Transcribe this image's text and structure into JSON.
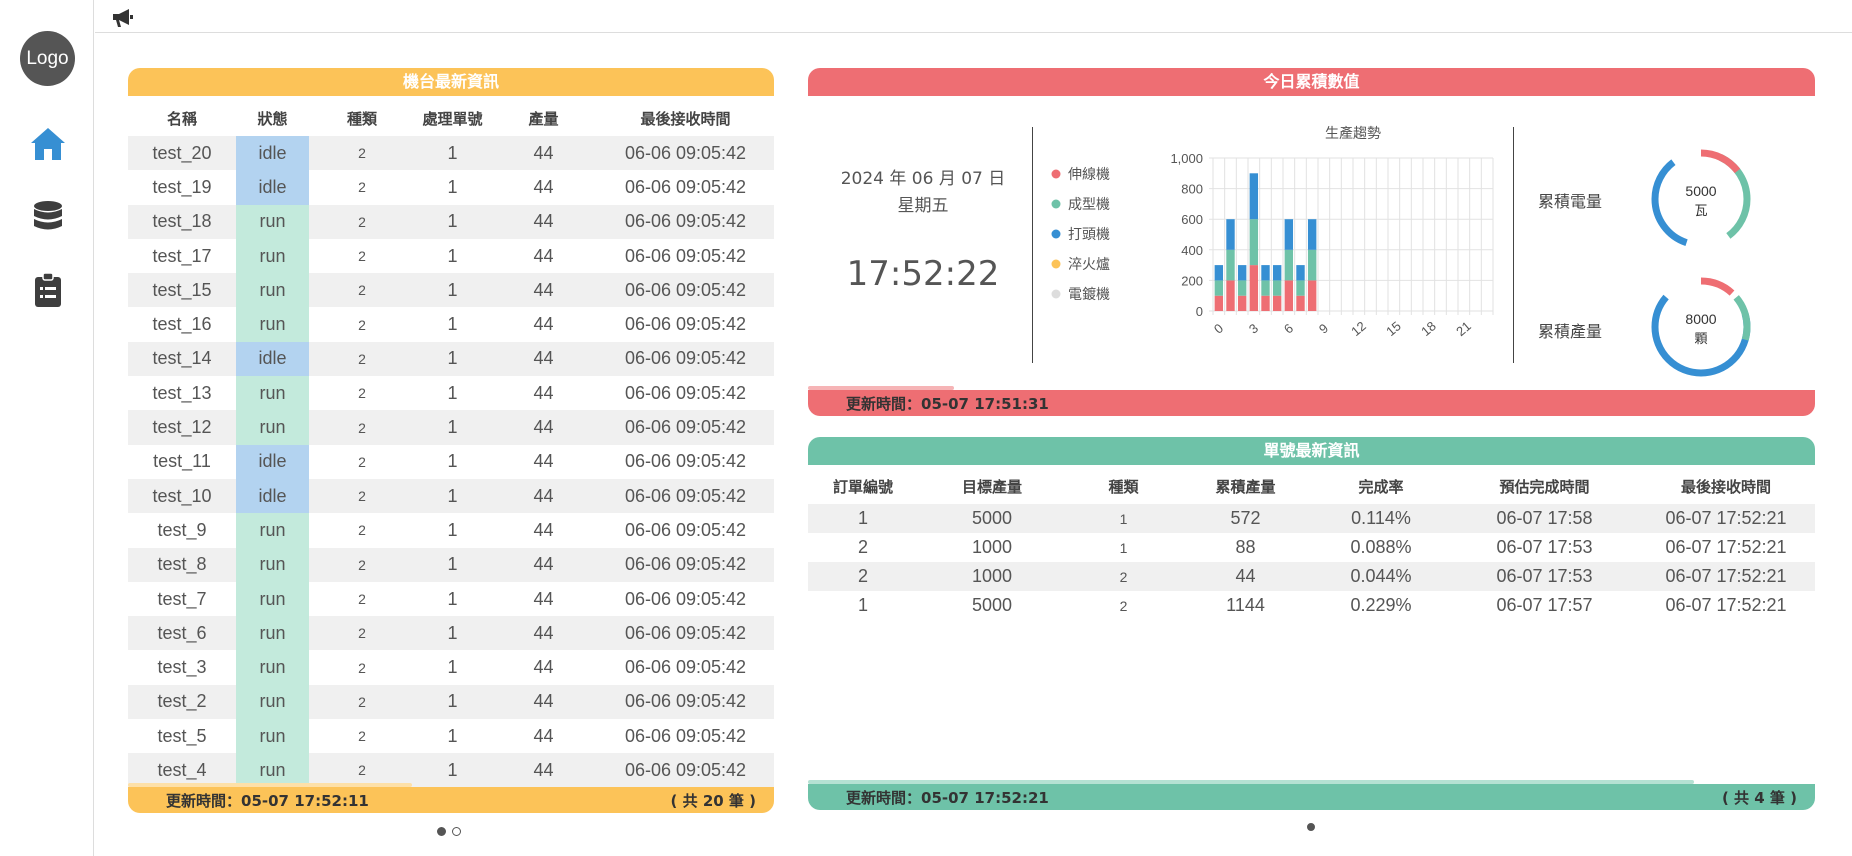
{
  "sidebar": {
    "logo": "Logo"
  },
  "machine_panel": {
    "title": "機台最新資訊",
    "columns": [
      "名稱",
      "狀態",
      "種類",
      "處理單號",
      "產量",
      "最後接收時間"
    ],
    "rows": [
      {
        "name": "test_20",
        "status": "idle",
        "type": "2",
        "order": "1",
        "output": "44",
        "time": "06-06 09:05:42"
      },
      {
        "name": "test_19",
        "status": "idle",
        "type": "2",
        "order": "1",
        "output": "44",
        "time": "06-06 09:05:42"
      },
      {
        "name": "test_18",
        "status": "run",
        "type": "2",
        "order": "1",
        "output": "44",
        "time": "06-06 09:05:42"
      },
      {
        "name": "test_17",
        "status": "run",
        "type": "2",
        "order": "1",
        "output": "44",
        "time": "06-06 09:05:42"
      },
      {
        "name": "test_15",
        "status": "run",
        "type": "2",
        "order": "1",
        "output": "44",
        "time": "06-06 09:05:42"
      },
      {
        "name": "test_16",
        "status": "run",
        "type": "2",
        "order": "1",
        "output": "44",
        "time": "06-06 09:05:42"
      },
      {
        "name": "test_14",
        "status": "idle",
        "type": "2",
        "order": "1",
        "output": "44",
        "time": "06-06 09:05:42"
      },
      {
        "name": "test_13",
        "status": "run",
        "type": "2",
        "order": "1",
        "output": "44",
        "time": "06-06 09:05:42"
      },
      {
        "name": "test_12",
        "status": "run",
        "type": "2",
        "order": "1",
        "output": "44",
        "time": "06-06 09:05:42"
      },
      {
        "name": "test_11",
        "status": "idle",
        "type": "2",
        "order": "1",
        "output": "44",
        "time": "06-06 09:05:42"
      },
      {
        "name": "test_10",
        "status": "idle",
        "type": "2",
        "order": "1",
        "output": "44",
        "time": "06-06 09:05:42"
      },
      {
        "name": "test_9",
        "status": "run",
        "type": "2",
        "order": "1",
        "output": "44",
        "time": "06-06 09:05:42"
      },
      {
        "name": "test_8",
        "status": "run",
        "type": "2",
        "order": "1",
        "output": "44",
        "time": "06-06 09:05:42"
      },
      {
        "name": "test_7",
        "status": "run",
        "type": "2",
        "order": "1",
        "output": "44",
        "time": "06-06 09:05:42"
      },
      {
        "name": "test_6",
        "status": "run",
        "type": "2",
        "order": "1",
        "output": "44",
        "time": "06-06 09:05:42"
      },
      {
        "name": "test_3",
        "status": "run",
        "type": "2",
        "order": "1",
        "output": "44",
        "time": "06-06 09:05:42"
      },
      {
        "name": "test_2",
        "status": "run",
        "type": "2",
        "order": "1",
        "output": "44",
        "time": "06-06 09:05:42"
      },
      {
        "name": "test_5",
        "status": "run",
        "type": "2",
        "order": "1",
        "output": "44",
        "time": "06-06 09:05:42"
      },
      {
        "name": "test_4",
        "status": "run",
        "type": "2",
        "order": "1",
        "output": "44",
        "time": "06-06 09:05:42"
      }
    ],
    "footer_update": "更新時間：05-07 17:52:11",
    "footer_count": "( 共 20 筆 )",
    "refresh_progress": 0.44
  },
  "daily_panel": {
    "title": "今日累積數值",
    "date": "2024 年 06 月 07 日",
    "weekday": "星期五",
    "time": "17:52:22",
    "footer_update": "更新時間：05-07 17:51:31",
    "refresh_progress": 0.145,
    "gauges": [
      {
        "label": "累積電量",
        "value": "5000",
        "unit": "瓦"
      },
      {
        "label": "累積產量",
        "value": "8000",
        "unit": "顆"
      }
    ]
  },
  "order_panel": {
    "title": "單號最新資訊",
    "columns": [
      "訂單編號",
      "目標產量",
      "種類",
      "累積產量",
      "完成率",
      "預估完成時間",
      "最後接收時間"
    ],
    "rows": [
      {
        "order": "1",
        "target": "5000",
        "type": "1",
        "accum": "572",
        "rate": "0.114%",
        "eta": "06-07 17:58",
        "last": "06-07 17:52:21"
      },
      {
        "order": "2",
        "target": "1000",
        "type": "1",
        "accum": "88",
        "rate": "0.088%",
        "eta": "06-07 17:53",
        "last": "06-07 17:52:21"
      },
      {
        "order": "2",
        "target": "1000",
        "type": "2",
        "accum": "44",
        "rate": "0.044%",
        "eta": "06-07 17:53",
        "last": "06-07 17:52:21"
      },
      {
        "order": "1",
        "target": "5000",
        "type": "2",
        "accum": "1144",
        "rate": "0.229%",
        "eta": "06-07 17:57",
        "last": "06-07 17:52:21"
      }
    ],
    "footer_update": "更新時間：05-07 17:52:21",
    "footer_count": "( 共 4 筆 )",
    "refresh_progress": 0.88
  },
  "colors": {
    "yellow": "#fcc358",
    "red": "#ee6e73",
    "teal": "#6ec2a8",
    "blue": "#368fd3",
    "gray": "#dddddd"
  },
  "chart_data": {
    "type": "bar",
    "stacked": true,
    "title": "生產趨勢",
    "x": [
      0,
      1,
      2,
      3,
      4,
      5,
      6,
      7,
      8,
      9,
      10,
      11,
      12,
      13,
      14,
      15,
      16,
      17,
      18,
      19,
      20,
      21,
      22,
      23
    ],
    "x_tick_labels": [
      "0",
      "3",
      "6",
      "9",
      "12",
      "15",
      "18",
      "21"
    ],
    "ylim": [
      0,
      1000
    ],
    "y_tick_labels": [
      "0",
      "200",
      "400",
      "600",
      "800",
      "1,000"
    ],
    "legend_position": "left",
    "grid": true,
    "series": [
      {
        "name": "伸線機",
        "color": "#ee6e73",
        "values": [
          100,
          200,
          100,
          300,
          100,
          100,
          200,
          100,
          200,
          0,
          0,
          0,
          0,
          0,
          0,
          0,
          0,
          0,
          0,
          0,
          0,
          0,
          0,
          0
        ]
      },
      {
        "name": "成型機",
        "color": "#6ec2a8",
        "values": [
          100,
          200,
          100,
          300,
          100,
          100,
          200,
          100,
          200,
          0,
          0,
          0,
          0,
          0,
          0,
          0,
          0,
          0,
          0,
          0,
          0,
          0,
          0,
          0
        ]
      },
      {
        "name": "打頭機",
        "color": "#368fd3",
        "values": [
          100,
          200,
          100,
          300,
          100,
          100,
          200,
          100,
          200,
          0,
          0,
          0,
          0,
          0,
          0,
          0,
          0,
          0,
          0,
          0,
          0,
          0,
          0,
          0
        ]
      },
      {
        "name": "淬火爐",
        "color": "#fcc358",
        "values": [
          0,
          0,
          0,
          0,
          0,
          0,
          0,
          0,
          0,
          0,
          0,
          0,
          0,
          0,
          0,
          0,
          0,
          0,
          0,
          0,
          0,
          0,
          0,
          0
        ]
      },
      {
        "name": "電鍍機",
        "color": "#dddddd",
        "values": [
          0,
          0,
          0,
          0,
          0,
          0,
          0,
          0,
          0,
          0,
          0,
          0,
          0,
          0,
          0,
          0,
          0,
          0,
          0,
          0,
          0,
          0,
          0,
          0
        ]
      }
    ]
  }
}
